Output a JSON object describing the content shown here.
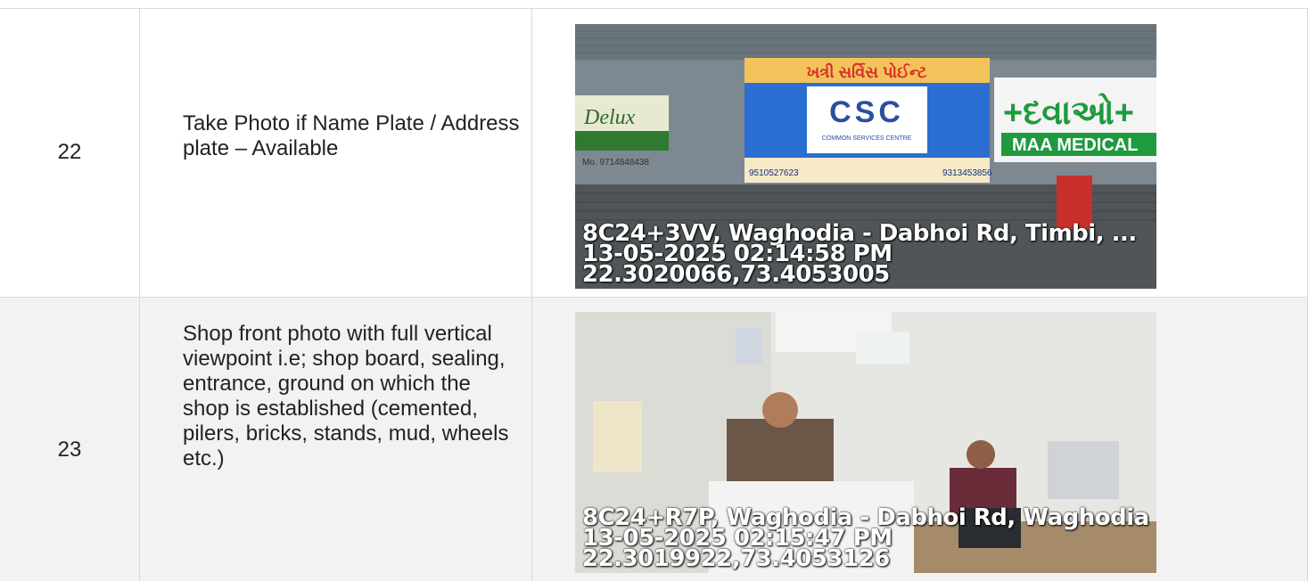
{
  "rows": [
    {
      "number": "22",
      "description": "Take Photo if Name Plate / Address plate – Available",
      "photo": {
        "sign_board_title": "ખત્રી સર્વિસ પોઈન્ટ",
        "sign_logo": "CSC",
        "sign_subtitle": "COMMON SERVICES CENTRE",
        "sign_phone_left": "9510527623",
        "sign_phone_right": "9313453856",
        "side_sign_left": "Delux",
        "side_sign_left_phone": "Mo. 9714848438",
        "side_sign_right_text": "+દવાઓ+",
        "side_sign_right_sub": "MAA MEDICAL",
        "geo_address": "8C24+3VV, Waghodia - Dabhoi Rd, Timbi, ...",
        "geo_datetime": "13-05-2025 02:14:58 PM",
        "geo_coords": "22.3020066,73.4053005"
      }
    },
    {
      "number": "23",
      "description": "Shop front photo with full vertical viewpoint i.e; shop board, sealing, entrance, ground on which the shop is established (cemented, pilers, bricks, stands, mud, wheels etc.)",
      "photo": {
        "geo_address": "8C24+R7P, Waghodia - Dabhoi Rd, Waghodia",
        "geo_datetime": "13-05-2025 02:15:47 PM",
        "geo_coords": "22.3019922,73.4053126"
      }
    }
  ]
}
